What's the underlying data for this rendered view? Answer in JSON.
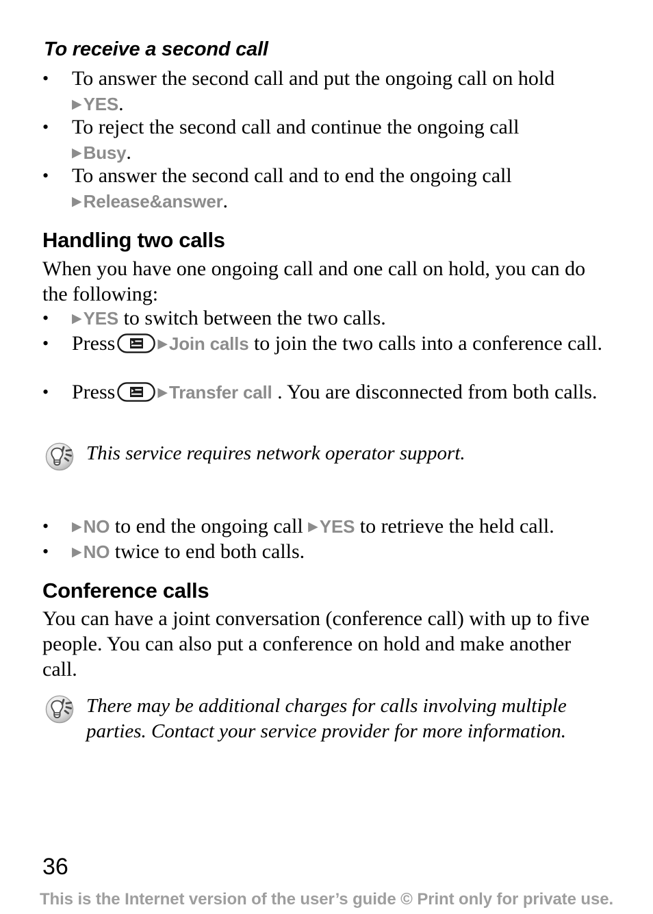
{
  "page": {
    "number": "36",
    "footer_note": "This is the Internet version of the user’s guide © Print only for private use."
  },
  "sections": [
    {
      "heading": "To receive a second call",
      "heading_style": "bold-italic",
      "bullets": [
        {
          "text_before": "To answer the second call and put the ongoing call on hold",
          "command": "YES",
          "text_after": "."
        },
        {
          "text_before": "To reject the second call and continue the ongoing call",
          "command": "Busy",
          "text_after": "."
        },
        {
          "text_before": "To answer the second call and to end the ongoing call",
          "command": "Release&answer",
          "text_after": "."
        }
      ]
    },
    {
      "heading": "Handling two calls",
      "heading_style": "bold",
      "intro": "When you have one ongoing call and one call on hold, you can do the following:",
      "bullets": [
        {
          "lead_arrow": true,
          "command": "YES",
          "text_after": " to switch between the two calls."
        },
        {
          "press_label": "Press",
          "icon": "menu-key-icon",
          "command": "Join calls",
          "text_after": " to join the two calls into a conference call."
        },
        {
          "press_label": "Press",
          "icon": "menu-key-icon",
          "command": "Transfer call",
          "text_after": " . You are disconnected from both calls."
        }
      ],
      "note": {
        "icon": "lightbulb-tip-icon",
        "text": "This service requires network operator support."
      },
      "bullets_after_note": [
        {
          "lead_arrow": true,
          "command": "NO",
          "text_middle": " to end the ongoing call ",
          "command2": "YES",
          "text_after": " to retrieve the held call."
        },
        {
          "lead_arrow": true,
          "command": "NO",
          "text_after": " twice to end both calls."
        }
      ]
    },
    {
      "heading": "Conference calls",
      "heading_style": "bold",
      "intro": "You can have a joint conversation (conference call) with up to five people. You can also put a conference on hold and make another call.",
      "note": {
        "icon": "lightbulb-tip-icon",
        "text": "There may be additional charges for calls involving multiple parties. Contact your service provider for more information."
      }
    }
  ],
  "glyphs": {
    "bullet": "•",
    "arrow": "▶"
  },
  "colors": {
    "command_grey": "#8c8c8c",
    "footer_grey": "#9e9e9e",
    "body_black": "#000000"
  }
}
